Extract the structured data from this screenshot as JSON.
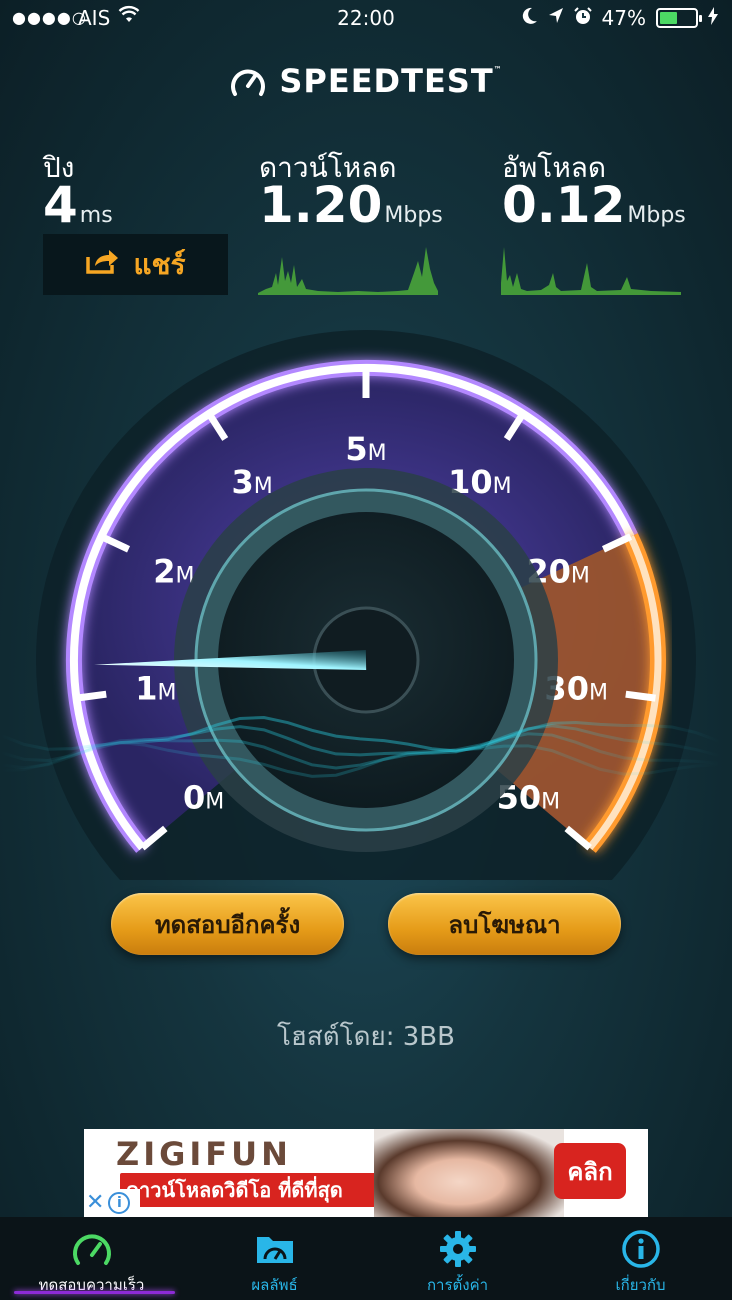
{
  "status_bar": {
    "signal_dots": "●●●●○",
    "carrier": "AIS",
    "time": "22:00",
    "battery": "47%",
    "battery_level": 0.47
  },
  "app": {
    "title": "SPEEDTEST",
    "trademark": "™"
  },
  "metrics": {
    "ping": {
      "label": "ปิง",
      "value": "4",
      "unit": "ms"
    },
    "download": {
      "label": "ดาวน์โหลด",
      "value": "1.20",
      "unit": "Mbps"
    },
    "upload": {
      "label": "อัพโหลด",
      "value": "0.12",
      "unit": "Mbps"
    }
  },
  "share_button": {
    "label": "แชร์",
    "icon": "share-icon"
  },
  "gauge": {
    "ticks": [
      {
        "num": "0",
        "unit": "M"
      },
      {
        "num": "1",
        "unit": "M"
      },
      {
        "num": "2",
        "unit": "M"
      },
      {
        "num": "3",
        "unit": "M"
      },
      {
        "num": "5",
        "unit": "M"
      },
      {
        "num": "10",
        "unit": "M"
      },
      {
        "num": "20",
        "unit": "M"
      },
      {
        "num": "30",
        "unit": "M"
      },
      {
        "num": "50",
        "unit": "M"
      }
    ],
    "needle_value_mbps": 1.2,
    "colors": {
      "primary_arc": "#b388ff",
      "orange_arc": "#ff9a2e",
      "needle": "#9ff4ff"
    }
  },
  "buttons": {
    "test_again": "ทดสอบอีกครั้ง",
    "remove_ads": "ลบโฆษณา"
  },
  "host": {
    "text": "โฮสต์โดย: 3BB"
  },
  "ad": {
    "brand": "ZIGIFUN",
    "tagline": "ดาวน์โหลดวิดีโอ ที่ดีที่สุด",
    "cta": "คลิก",
    "close": "✕",
    "info": "i"
  },
  "tabs": [
    {
      "label": "ทดสอบความเร็ว",
      "icon": "speedometer-icon"
    },
    {
      "label": "ผลลัพธ์",
      "icon": "folder-icon"
    },
    {
      "label": "การตั้งค่า",
      "icon": "gear-icon"
    },
    {
      "label": "เกี่ยวกับ",
      "icon": "info-icon"
    }
  ],
  "colors": {
    "accent": "#29b6e8",
    "button_gold": "#f0a92a",
    "share_orange": "#f6a623"
  }
}
